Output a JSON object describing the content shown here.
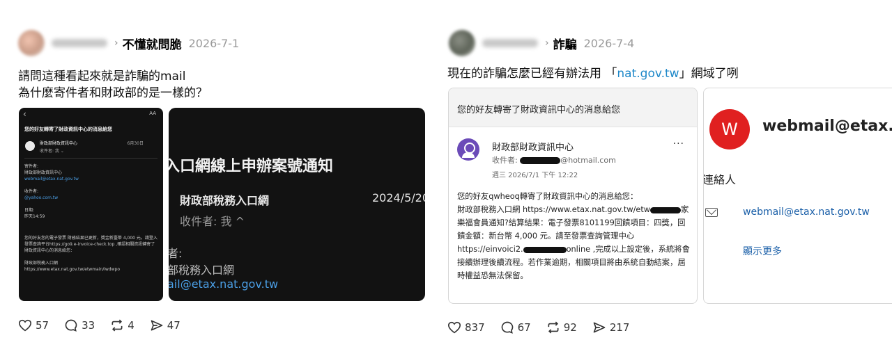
{
  "posts": [
    {
      "topic": "不懂就問脆",
      "date": "2026-7-1",
      "text": "請問這種看起來就是詐騙的mail\n為什麼寄件者和財政部的是一樣的？",
      "screenshot1": {
        "back": "‹",
        "aa": "AA",
        "subject": "您的好友轉寄了財政資訊中心的消息給您",
        "sender": "財政部財政資訊中心",
        "recipient": "收件者: 我 ⌄",
        "sent_date": "6月30日",
        "info_from_label": "寄件者:",
        "info_from_name": "財政部財政資訊中心",
        "info_from_email": "webmail@etax.nat.gov.tw",
        "info_to_label": "收件者:",
        "info_to_email": "@yahoo.com.tw",
        "info_date_label": "日期:",
        "info_date": "昨天14:59",
        "message": "您的好友您的電子發票  財務結果已更新，獎金新臺幣 4,000 元。請登入發票查詢平台https://go9.e-invoice-check.top ,確認相關資訊轉寄了財政資訊中心的消息給您：",
        "message2": "財政部稅務入口網",
        "message3": "https://www.etax.nat.gov.tw/etwmain/iwdwpo"
      },
      "screenshot2": {
        "headline": "入口網線上申辦案號通知",
        "sender": "財政部稅務入口網",
        "recipient": "收件者: 我 ^",
        "date": "2024/5/20",
        "from_label": "者:",
        "from_org": "部稅務入口網",
        "from_email": "ail@etax.nat.gov.tw"
      },
      "stats": {
        "likes": "57",
        "comments": "33",
        "reposts": "4",
        "shares": "47"
      }
    },
    {
      "topic": "詐騙",
      "date": "2026-7-4",
      "text_before": "現在的詐騙怎麼已經有辦法用 「",
      "text_link": "nat.gov.tw",
      "text_after": "」網域了咧",
      "screenshot1": {
        "subject": "您的好友轉寄了財政資訊中心的消息給您",
        "sender": "財政部財政資訊中心",
        "recipient_label": "收件者:",
        "recipient_domain": "@hotmail.com",
        "datetime": "週三 2026/7/1 下午 12:22",
        "more": "···",
        "body_1": "您的好友qwheoq轉寄了財政資訊中心的消息給您：",
        "body_2a": "財政部稅務入口網 https://www.etax.nat.gov.tw/etw",
        "body_2b": "家",
        "body_3": "樂福會員通知?結算結果：電子發票8101199回饋項目：四獎，回饋金額：新台幣 4,000 元。請至發票查詢管理中心",
        "body_4a": "https://einvoici2.",
        "body_4b": "online ,完成以上設定後，系統將會接續辦理後續流程。若作業逾期，相關項目將由系統自動結案，屆時權益恐無法保留。"
      },
      "screenshot2": {
        "avatar_letter": "W",
        "title": "webmail@etax.",
        "contact": "連絡人",
        "email": "webmail@etax.nat.gov.tw",
        "show_more": "顯示更多"
      },
      "stats": {
        "likes": "837",
        "comments": "67",
        "reposts": "92",
        "shares": "217"
      }
    }
  ],
  "colors": {
    "accent_link": "#1e88c9",
    "red_avatar": "#e02020",
    "purple_avatar": "#6b4bb8"
  }
}
